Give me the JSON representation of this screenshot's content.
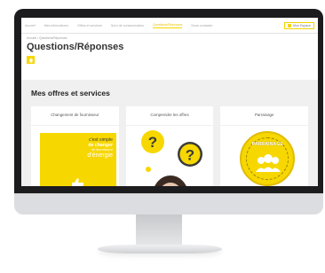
{
  "nav": {
    "items": [
      {
        "label": "Accueil",
        "active": false
      },
      {
        "label": "Mes informations",
        "active": false
      },
      {
        "label": "Offres et services",
        "active": false
      },
      {
        "label": "Suivi de consommation",
        "active": false
      },
      {
        "label": "Questions/Réponses",
        "active": true
      },
      {
        "label": "Nous contacter",
        "active": false
      }
    ],
    "user_label": "Mon Espace"
  },
  "header": {
    "breadcrumb": "Accueil • Questions/Réponses",
    "title": "Questions/Réponses"
  },
  "section": {
    "title": "Mes offres et services"
  },
  "cards": [
    {
      "title": "Changement de fournisseur",
      "image_text": [
        "c'est simple",
        "de changer",
        "de fournisseur",
        "d'énergie"
      ]
    },
    {
      "title": "Comprendre les offres"
    },
    {
      "title": "Parrainage",
      "badge_text": "PARRAINAGE"
    }
  ],
  "colors": {
    "accent": "#f7d700",
    "screen_bg": "#f0f0f0",
    "bezel": "#1c1c1e"
  }
}
